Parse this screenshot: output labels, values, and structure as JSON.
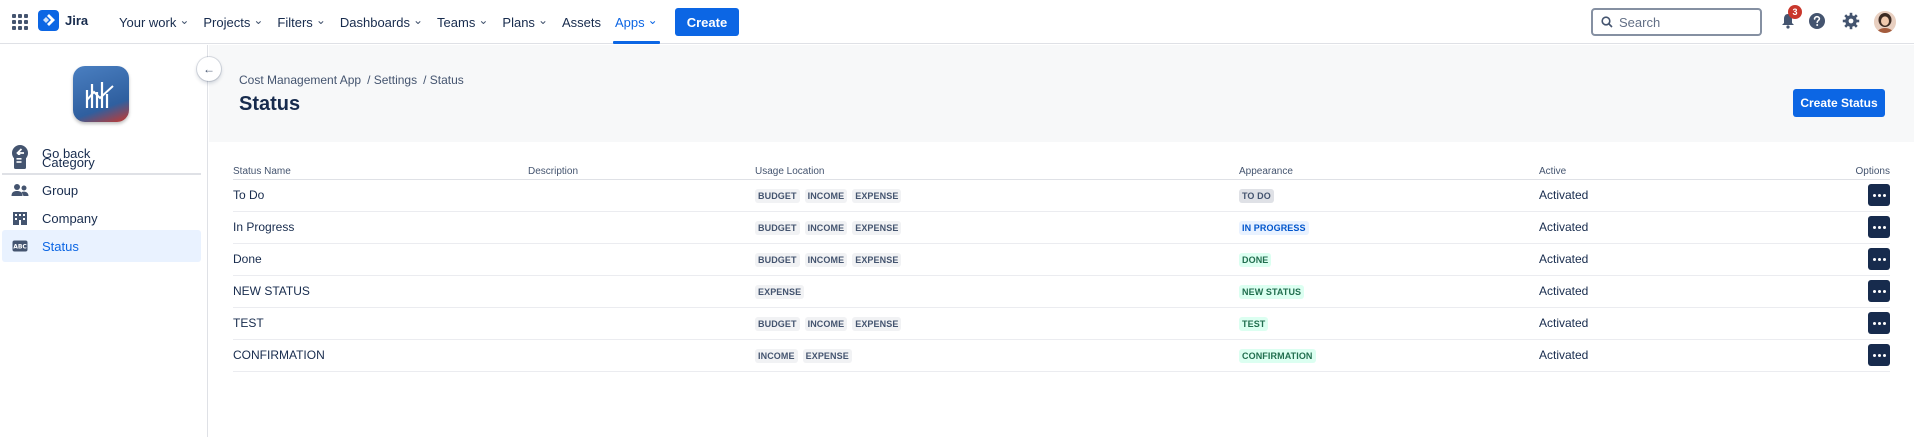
{
  "nav": {
    "logo_text": "Jira",
    "items": [
      {
        "label": "Your work",
        "dropdown": true
      },
      {
        "label": "Projects",
        "dropdown": true
      },
      {
        "label": "Filters",
        "dropdown": true
      },
      {
        "label": "Dashboards",
        "dropdown": true
      },
      {
        "label": "Teams",
        "dropdown": true
      },
      {
        "label": "Plans",
        "dropdown": true
      },
      {
        "label": "Assets",
        "dropdown": false
      },
      {
        "label": "Apps",
        "dropdown": true,
        "active": true
      }
    ],
    "create_label": "Create",
    "search_placeholder": "Search",
    "notifications_count": "3",
    "icons": [
      "app-switcher-icon",
      "notifications-icon",
      "help-icon",
      "settings-icon"
    ]
  },
  "sidebar": {
    "back_label": "Go back",
    "items": [
      {
        "label": "Category",
        "icon": "category-icon"
      },
      {
        "label": "Group",
        "icon": "group-icon"
      },
      {
        "label": "Company",
        "icon": "company-icon"
      },
      {
        "label": "Status",
        "icon": "status-icon",
        "selected": true
      }
    ]
  },
  "page": {
    "breadcrumb": [
      "Cost Management App",
      "/ Settings",
      "/ Status"
    ],
    "title": "Status",
    "create_button": "Create Status"
  },
  "table": {
    "columns": [
      "Status Name",
      "Description",
      "Usage Location",
      "Appearance",
      "Active",
      "Options"
    ],
    "rows": [
      {
        "name": "To Do",
        "description": "",
        "usage": [
          "BUDGET",
          "INCOME",
          "EXPENSE"
        ],
        "appearance": "TO DO",
        "appearance_color": "grey",
        "active": "Activated"
      },
      {
        "name": "In Progress",
        "description": "",
        "usage": [
          "BUDGET",
          "INCOME",
          "EXPENSE"
        ],
        "appearance": "IN PROGRESS",
        "appearance_color": "blue",
        "active": "Activated"
      },
      {
        "name": "Done",
        "description": "",
        "usage": [
          "BUDGET",
          "INCOME",
          "EXPENSE"
        ],
        "appearance": "DONE",
        "appearance_color": "green",
        "active": "Activated"
      },
      {
        "name": "NEW STATUS",
        "description": "",
        "usage": [
          "EXPENSE"
        ],
        "appearance": "NEW STATUS",
        "appearance_color": "green",
        "active": "Activated"
      },
      {
        "name": "TEST",
        "description": "",
        "usage": [
          "BUDGET",
          "INCOME",
          "EXPENSE"
        ],
        "appearance": "TEST",
        "appearance_color": "green",
        "active": "Activated"
      },
      {
        "name": "CONFIRMATION",
        "description": "",
        "usage": [
          "INCOME",
          "EXPENSE"
        ],
        "appearance": "CONFIRMATION",
        "appearance_color": "green",
        "active": "Activated"
      }
    ]
  },
  "colors": {
    "accent": "#0c66e4",
    "text": "#172b4d",
    "selected_bg": "#e9f2ff",
    "badge": "#c9372c"
  }
}
